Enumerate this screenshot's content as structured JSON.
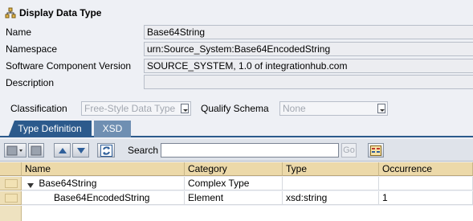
{
  "header": {
    "title": "Display Data Type"
  },
  "form": {
    "name_label": "Name",
    "name_value": "Base64String",
    "namespace_label": "Namespace",
    "namespace_value": "urn:Source_System:Base64EncodedString",
    "swcv_label": "Software Component Version",
    "swcv_value": "SOURCE_SYSTEM, 1.0 of integrationhub.com",
    "description_label": "Description",
    "description_value": ""
  },
  "classification": {
    "label": "Classification",
    "value": "Free-Style Data Type",
    "qualify_label": "Qualify Schema",
    "qualify_value": "None"
  },
  "tabs": [
    {
      "label": "Type Definition",
      "active": true
    },
    {
      "label": "XSD",
      "active": false
    }
  ],
  "toolbar": {
    "search_label": "Search",
    "search_value": "",
    "go_label": "Go"
  },
  "table": {
    "columns": [
      "Name",
      "Category",
      "Type",
      "Occurrence"
    ],
    "rows": [
      {
        "name": "Base64String",
        "category": "Complex Type",
        "type": "",
        "occurrence": "",
        "expanded": true,
        "level": 0
      },
      {
        "name": "Base64EncodedString",
        "category": "Element",
        "type": "xsd:string",
        "occurrence": "1",
        "level": 1
      }
    ]
  },
  "colors": {
    "tab_active": "#2c5a8c",
    "tab_inactive": "#6f8fb2",
    "table_header": "#ecd9a9",
    "background": "#eef0f5"
  }
}
